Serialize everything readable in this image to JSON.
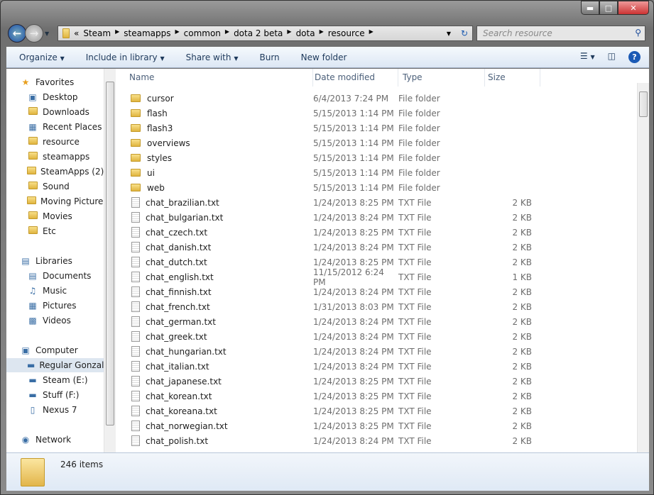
{
  "window": {
    "controls": [
      "minimize",
      "maximize",
      "close"
    ]
  },
  "address": {
    "overflow": "«",
    "segments": [
      "Steam",
      "steamapps",
      "common",
      "dota 2 beta",
      "dota",
      "resource"
    ]
  },
  "search": {
    "placeholder": "Search resource"
  },
  "toolbar": {
    "organize": "Organize",
    "include": "Include in library",
    "share": "Share with",
    "burn": "Burn",
    "new_folder": "New folder"
  },
  "sidebar": {
    "items": [
      {
        "label": "Favorites",
        "icon": "star-icon",
        "head": true
      },
      {
        "label": "Desktop",
        "icon": "desktop-icon"
      },
      {
        "label": "Downloads",
        "icon": "folder-icon"
      },
      {
        "label": "Recent Places",
        "icon": "recent-places-icon"
      },
      {
        "label": "resource",
        "icon": "folder-icon"
      },
      {
        "label": "steamapps",
        "icon": "folder-icon"
      },
      {
        "label": "SteamApps (2)",
        "icon": "folder-icon"
      },
      {
        "label": "Sound",
        "icon": "folder-icon"
      },
      {
        "label": "Moving Pictures",
        "icon": "folder-icon"
      },
      {
        "label": "Movies",
        "icon": "folder-icon"
      },
      {
        "label": "Etc",
        "icon": "folder-icon"
      },
      null,
      {
        "label": "Libraries",
        "icon": "libraries-icon",
        "head": true
      },
      {
        "label": "Documents",
        "icon": "documents-icon"
      },
      {
        "label": "Music",
        "icon": "music-icon"
      },
      {
        "label": "Pictures",
        "icon": "pictures-icon"
      },
      {
        "label": "Videos",
        "icon": "videos-icon"
      },
      null,
      {
        "label": "Computer",
        "icon": "computer-icon",
        "head": true
      },
      {
        "label": "Regular Gonzalez",
        "icon": "drive-icon",
        "selected": true
      },
      {
        "label": "Steam (E:)",
        "icon": "drive-icon"
      },
      {
        "label": "Stuff (F:)",
        "icon": "drive-icon"
      },
      {
        "label": "Nexus 7",
        "icon": "device-icon"
      },
      null,
      {
        "label": "Network",
        "icon": "network-icon",
        "head": true
      }
    ]
  },
  "columns": {
    "name": "Name",
    "date": "Date modified",
    "type": "Type",
    "size": "Size"
  },
  "files": [
    {
      "name": "cursor",
      "date": "6/4/2013 7:24 PM",
      "type": "File folder",
      "size": "",
      "folder": true
    },
    {
      "name": "flash",
      "date": "5/15/2013 1:14 PM",
      "type": "File folder",
      "size": "",
      "folder": true
    },
    {
      "name": "flash3",
      "date": "5/15/2013 1:14 PM",
      "type": "File folder",
      "size": "",
      "folder": true
    },
    {
      "name": "overviews",
      "date": "5/15/2013 1:14 PM",
      "type": "File folder",
      "size": "",
      "folder": true
    },
    {
      "name": "styles",
      "date": "5/15/2013 1:14 PM",
      "type": "File folder",
      "size": "",
      "folder": true
    },
    {
      "name": "ui",
      "date": "5/15/2013 1:14 PM",
      "type": "File folder",
      "size": "",
      "folder": true
    },
    {
      "name": "web",
      "date": "5/15/2013 1:14 PM",
      "type": "File folder",
      "size": "",
      "folder": true
    },
    {
      "name": "chat_brazilian.txt",
      "date": "1/24/2013 8:25 PM",
      "type": "TXT File",
      "size": "2 KB"
    },
    {
      "name": "chat_bulgarian.txt",
      "date": "1/24/2013 8:24 PM",
      "type": "TXT File",
      "size": "2 KB"
    },
    {
      "name": "chat_czech.txt",
      "date": "1/24/2013 8:25 PM",
      "type": "TXT File",
      "size": "2 KB"
    },
    {
      "name": "chat_danish.txt",
      "date": "1/24/2013 8:24 PM",
      "type": "TXT File",
      "size": "2 KB"
    },
    {
      "name": "chat_dutch.txt",
      "date": "1/24/2013 8:25 PM",
      "type": "TXT File",
      "size": "2 KB"
    },
    {
      "name": "chat_english.txt",
      "date": "11/15/2012 6:24 PM",
      "type": "TXT File",
      "size": "1 KB"
    },
    {
      "name": "chat_finnish.txt",
      "date": "1/24/2013 8:24 PM",
      "type": "TXT File",
      "size": "2 KB"
    },
    {
      "name": "chat_french.txt",
      "date": "1/31/2013 8:03 PM",
      "type": "TXT File",
      "size": "2 KB"
    },
    {
      "name": "chat_german.txt",
      "date": "1/24/2013 8:24 PM",
      "type": "TXT File",
      "size": "2 KB"
    },
    {
      "name": "chat_greek.txt",
      "date": "1/24/2013 8:24 PM",
      "type": "TXT File",
      "size": "2 KB"
    },
    {
      "name": "chat_hungarian.txt",
      "date": "1/24/2013 8:24 PM",
      "type": "TXT File",
      "size": "2 KB"
    },
    {
      "name": "chat_italian.txt",
      "date": "1/24/2013 8:24 PM",
      "type": "TXT File",
      "size": "2 KB"
    },
    {
      "name": "chat_japanese.txt",
      "date": "1/24/2013 8:25 PM",
      "type": "TXT File",
      "size": "2 KB"
    },
    {
      "name": "chat_korean.txt",
      "date": "1/24/2013 8:25 PM",
      "type": "TXT File",
      "size": "2 KB"
    },
    {
      "name": "chat_koreana.txt",
      "date": "1/24/2013 8:25 PM",
      "type": "TXT File",
      "size": "2 KB"
    },
    {
      "name": "chat_norwegian.txt",
      "date": "1/24/2013 8:25 PM",
      "type": "TXT File",
      "size": "2 KB"
    },
    {
      "name": "chat_polish.txt",
      "date": "1/24/2013 8:24 PM",
      "type": "TXT File",
      "size": "2 KB"
    }
  ],
  "status": {
    "count": "246 items"
  }
}
